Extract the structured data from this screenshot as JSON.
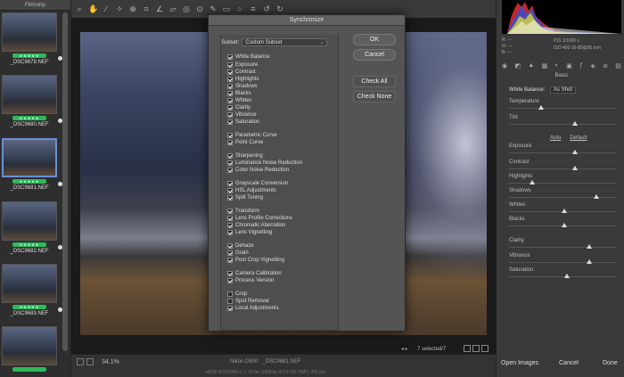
{
  "filmstrip": {
    "title": "Filmstrip",
    "items": [
      {
        "name": "_DSC9679.NEF",
        "stars": "★★★★★"
      },
      {
        "name": "_DSC9680.NEF",
        "stars": "★★★★★"
      },
      {
        "name": "_DSC9681.NEF",
        "stars": "★★★★★"
      },
      {
        "name": "_DSC9682.NEF",
        "stars": "★★★★★"
      },
      {
        "name": "_DSC9683.NEF",
        "stars": "★★★★★"
      }
    ]
  },
  "dialog": {
    "title": "Synchronize",
    "subset_label": "Subset:",
    "subset_value": "Custom Subset",
    "ok": "OK",
    "cancel": "Cancel",
    "check_all": "Check All",
    "check_none": "Check None",
    "items": [
      {
        "label": "White Balance",
        "checked": true
      },
      {
        "label": "Exposure",
        "checked": true
      },
      {
        "label": "Contrast",
        "checked": true
      },
      {
        "label": "Highlights",
        "checked": true
      },
      {
        "label": "Shadows",
        "checked": true
      },
      {
        "label": "Blacks",
        "checked": true
      },
      {
        "label": "Whites",
        "checked": true
      },
      {
        "label": "Clarity",
        "checked": true
      },
      {
        "label": "Vibrance",
        "checked": true
      },
      {
        "label": "Saturation",
        "checked": true
      },
      {
        "label": "Parametric Curve",
        "checked": true
      },
      {
        "label": "Point Curve",
        "checked": true
      },
      {
        "label": "Sharpening",
        "checked": true
      },
      {
        "label": "Luminance Noise Reduction",
        "checked": true
      },
      {
        "label": "Color Noise Reduction",
        "checked": true
      },
      {
        "label": "Grayscale Conversion",
        "checked": true
      },
      {
        "label": "HSL Adjustments",
        "checked": true
      },
      {
        "label": "Split Toning",
        "checked": true
      },
      {
        "label": "Transform",
        "checked": true
      },
      {
        "label": "Lens Profile Corrections",
        "checked": true
      },
      {
        "label": "Chromatic Aberration",
        "checked": true
      },
      {
        "label": "Lens Vignetting",
        "checked": true
      },
      {
        "label": "Dehaze",
        "checked": true
      },
      {
        "label": "Grain",
        "checked": true
      },
      {
        "label": "Post Crop Vignetting",
        "checked": true
      },
      {
        "label": "Camera Calibration",
        "checked": true
      },
      {
        "label": "Process Version",
        "checked": true
      },
      {
        "label": "Crop",
        "checked": false
      },
      {
        "label": "Spot Removal",
        "checked": false
      },
      {
        "label": "Local Adjustments",
        "checked": true
      }
    ]
  },
  "status": {
    "zoom": "34.1%",
    "camera": "Nikon D500 : _DSC9681.NEF",
    "selected": "7 selected/7",
    "workflow": "sRGB IEC61966-2.1; 16 bit; 5568 by 3712 (20.7MP); 300 ppi"
  },
  "right": {
    "rgb": [
      "R: ---",
      "G: ---",
      "B: ---"
    ],
    "exif": [
      "f/10  1/1000 s",
      "ISO 400  16-80@56 mm"
    ],
    "section": "Basic",
    "wb_label": "White Balance:",
    "wb_value": "As Shot",
    "auto": "Auto",
    "default": "Default",
    "sliders": [
      {
        "label": "Temperature",
        "value": "",
        "pos": 0.3
      },
      {
        "label": "Tint",
        "value": "",
        "pos": 0.62
      },
      {
        "label": "Exposure",
        "value": "",
        "pos": 0.62
      },
      {
        "label": "Contrast",
        "value": "",
        "pos": 0.62
      },
      {
        "label": "Highlights",
        "value": "",
        "pos": 0.22
      },
      {
        "label": "Shadows",
        "value": "",
        "pos": 0.82
      },
      {
        "label": "Whites",
        "value": "",
        "pos": 0.52
      },
      {
        "label": "Blacks",
        "value": "",
        "pos": 0.52
      },
      {
        "label": "Clarity",
        "value": "",
        "pos": 0.75
      },
      {
        "label": "Vibrance",
        "value": "",
        "pos": 0.75
      },
      {
        "label": "Saturation",
        "value": "",
        "pos": 0.54
      }
    ]
  },
  "bottom": {
    "open": "Open Images",
    "cancel": "Cancel",
    "done": "Done"
  }
}
